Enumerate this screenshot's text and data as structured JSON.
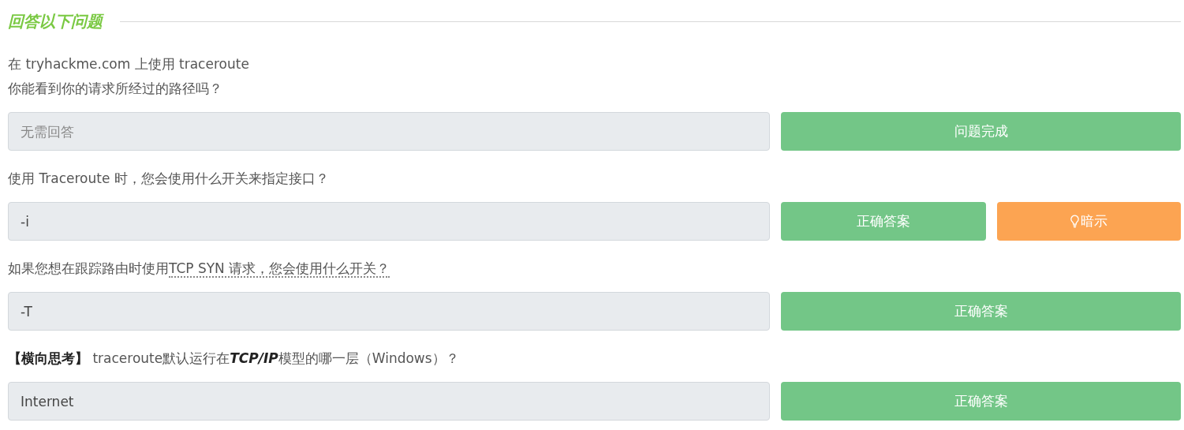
{
  "heading": "回答以下问题",
  "questions": [
    {
      "lines": [
        "在 tryhackme.com 上使用 traceroute",
        "你能看到你的请求所经过的路径吗？"
      ],
      "answer": {
        "placeholder": "无需回答"
      },
      "buttons": [
        {
          "kind": "complete",
          "label": "问题完成"
        }
      ]
    },
    {
      "lines": [
        "使用 Traceroute 时，您会使用什么开关来指定接口？"
      ],
      "answer": {
        "value": "-i"
      },
      "buttons": [
        {
          "kind": "correct",
          "label": "正确答案"
        },
        {
          "kind": "hint",
          "label": "暗示"
        }
      ]
    },
    {
      "lines": [
        "如果您想在跟踪路由时使用"
      ],
      "abbr": "TCP SYN 请求，您会使用什么开关？",
      "answer": {
        "value": "-T"
      },
      "buttons": [
        {
          "kind": "correct",
          "label": "正确答案"
        }
      ]
    },
    {
      "parts": [
        {
          "kind": "tag",
          "text": "【横向思考】"
        },
        {
          "kind": "text",
          "text": " traceroute默认运行在"
        },
        {
          "kind": "term",
          "text": "TCP/IP"
        },
        {
          "kind": "text",
          "text": "模型的哪一层（Windows）？"
        }
      ],
      "answer": {
        "value": "Internet"
      },
      "buttons": [
        {
          "kind": "correct",
          "label": "正确答案"
        }
      ]
    }
  ]
}
